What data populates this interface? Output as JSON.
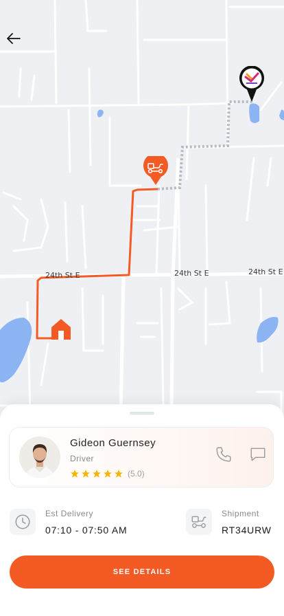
{
  "map": {
    "streets": [
      "24th St E",
      "24th St E",
      "24th St E"
    ],
    "route_color": "#f45a24"
  },
  "driver": {
    "name": "Gideon Guernsey",
    "role": "Driver",
    "rating": 5,
    "rating_text": "(5.0)"
  },
  "delivery": {
    "label": "Est Delivery",
    "value": "07:10 - 07:50 AM"
  },
  "shipment": {
    "label": "Shipment",
    "value": "RT34URW"
  },
  "cta_label": "SEE DETAILS",
  "colors": {
    "accent": "#f45a24",
    "star": "#f7b500"
  }
}
